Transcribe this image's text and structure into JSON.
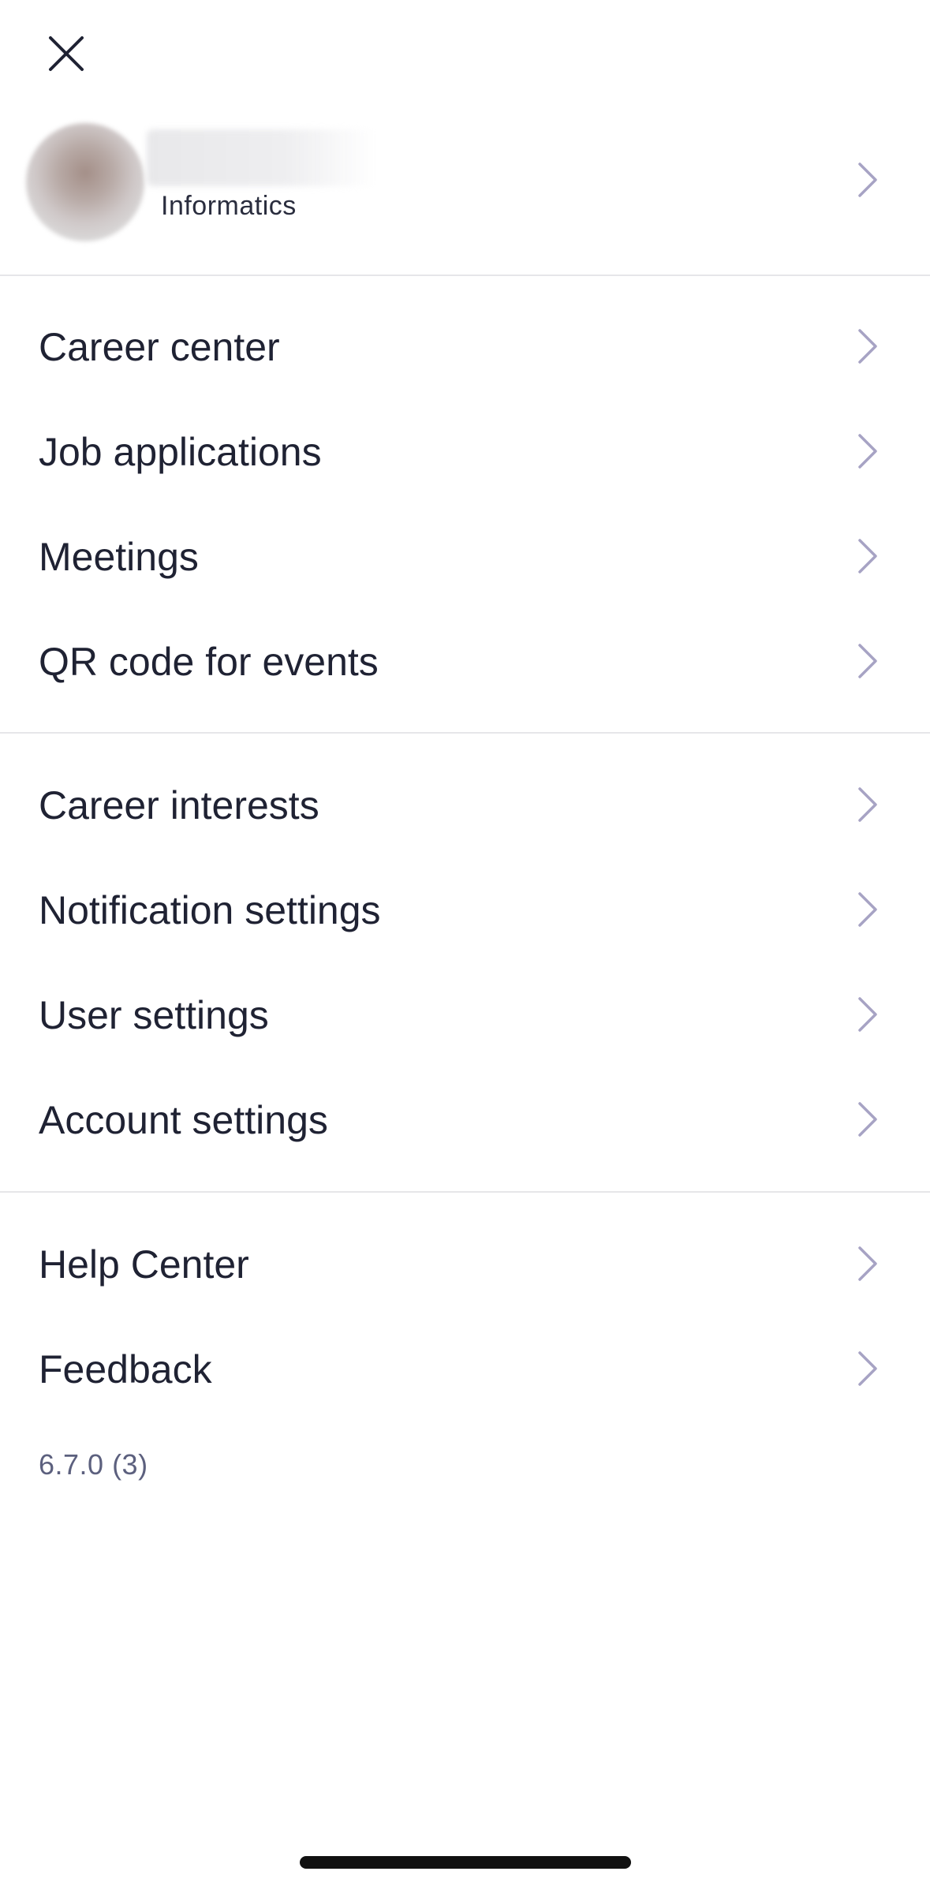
{
  "header": {
    "close_icon": "close-icon"
  },
  "profile": {
    "subtitle": "Informatics",
    "chevron_icon": "chevron-right-icon"
  },
  "sections": [
    {
      "items": [
        {
          "label": "Career center"
        },
        {
          "label": "Job applications"
        },
        {
          "label": "Meetings"
        },
        {
          "label": "QR code for events"
        }
      ]
    },
    {
      "items": [
        {
          "label": "Career interests"
        },
        {
          "label": "Notification settings"
        },
        {
          "label": "User settings"
        },
        {
          "label": "Account settings"
        }
      ]
    },
    {
      "items": [
        {
          "label": "Help Center"
        },
        {
          "label": "Feedback"
        }
      ]
    }
  ],
  "version": "6.7.0 (3)",
  "colors": {
    "text": "#1f2233",
    "chevron": "#a7a3c4",
    "divider": "#e6e6e9",
    "version_text": "#5c607e"
  }
}
